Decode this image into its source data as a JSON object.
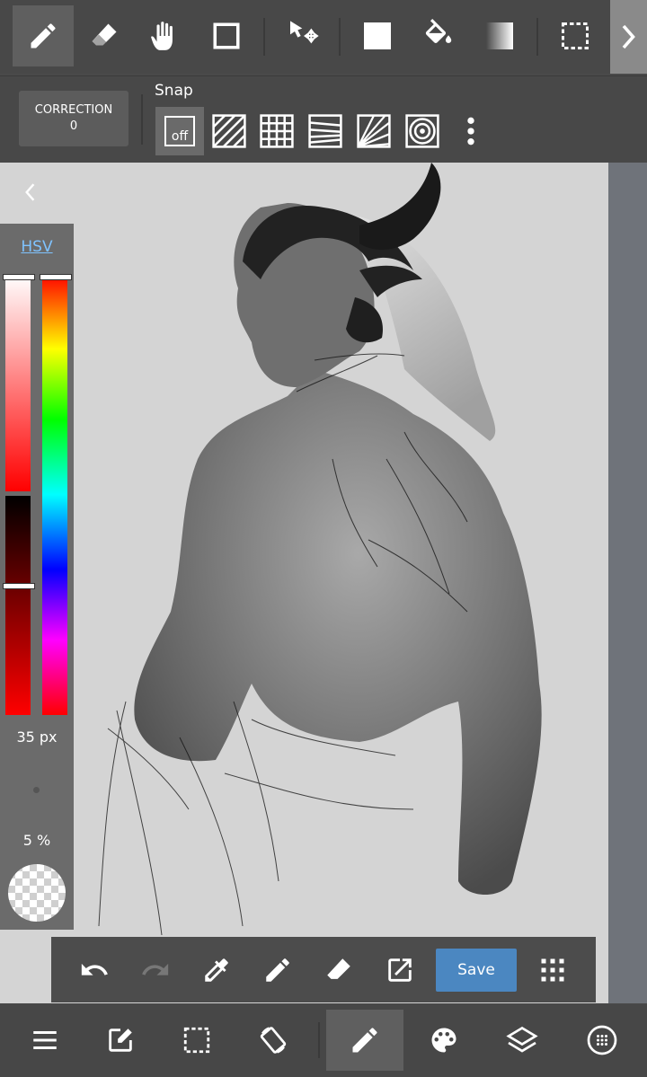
{
  "correction": {
    "label": "CORRECTION",
    "value": "0"
  },
  "snap": {
    "label": "Snap",
    "off_label": "off"
  },
  "color_panel": {
    "mode": "HSV",
    "brush_size": "35 px",
    "opacity": "5 %"
  },
  "actions": {
    "save_label": "Save"
  },
  "colors": {
    "accent": "#4b87c1",
    "hsv_link": "#7fc3ff",
    "toolbar_bg": "#484848",
    "canvas_bg": "#d4d4d4"
  },
  "icons": {
    "top_toolbar": [
      "pen-icon",
      "eraser-icon",
      "hand-icon",
      "square-outline-icon",
      "move-selection-icon",
      "fill-square-icon",
      "bucket-icon",
      "gradient-icon",
      "selection-icon",
      "chevron-right-icon"
    ],
    "snap": [
      "snap-off-icon",
      "snap-parallel-icon",
      "snap-grid-icon",
      "snap-perspective-icon",
      "snap-radial-icon",
      "snap-circle-icon",
      "more-vertical-icon"
    ],
    "actions": [
      "undo-icon",
      "redo-icon",
      "eyedropper-icon",
      "pen-icon",
      "eraser-icon",
      "export-icon",
      "apps-icon"
    ],
    "bottom_nav": [
      "menu-icon",
      "edit-icon",
      "selection-icon",
      "rotate-icon",
      "brush-icon",
      "palette-icon",
      "layers-icon",
      "material-icon"
    ]
  }
}
